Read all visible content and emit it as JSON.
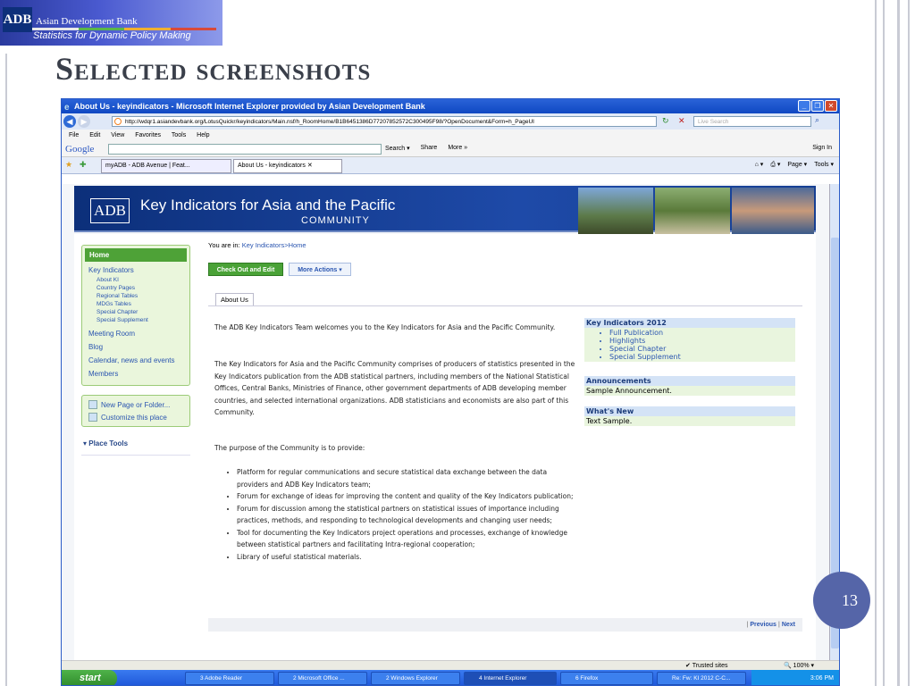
{
  "slide": {
    "logo_abbr": "ADB",
    "logo_name": "Asian Development Bank",
    "logo_tagline": "Statistics for Dynamic Policy Making",
    "title": "Selected screenshots",
    "page_number": "13"
  },
  "browser": {
    "window_title": "About Us - keyindicators - Microsoft Internet Explorer provided by Asian Development Bank",
    "url": "http://wdqr1.asiandevbank.org/LotusQuickr/keyindicators/Main.nsf/h_RoomHome/B1B6451386D77207852572C300495F98/?OpenDocument&Form=h_PageUI",
    "search_placeholder": "Live Search",
    "menu": [
      "File",
      "Edit",
      "View",
      "Favorites",
      "Tools",
      "Help"
    ],
    "google_logo": "Google",
    "google_tools": [
      "Search ▾",
      "Share",
      "More »"
    ],
    "sign_in": "Sign In",
    "tabs": [
      "myADB - ADB Avenue | Feat...",
      "About Us - keyindicators"
    ],
    "ie_tools": [
      "Page ▾",
      "Tools ▾"
    ],
    "status_zone": "Trusted sites",
    "zoom": "100%"
  },
  "site": {
    "banner_abbr": "ADB",
    "banner_title": "Key Indicators for Asia and the Pacific",
    "banner_subtitle": "COMMUNITY",
    "breadcrumb_prefix": "You are in:",
    "breadcrumb_link": "Key Indicators",
    "breadcrumb_current": ">Home",
    "btn_checkout": "Check Out and Edit",
    "btn_more": "More Actions ▾",
    "content_tab": "About Us",
    "sidebar": {
      "home": "Home",
      "key_indicators": "Key Indicators",
      "sub_items": [
        "About KI",
        "Country Pages",
        "Regional Tables",
        "MDGs Tables",
        "Special Chapter",
        "Special Supplement"
      ],
      "items": [
        "Meeting Room",
        "Blog",
        "Calendar, news and events",
        "Members"
      ],
      "tools": [
        "New Page or Folder...",
        "Customize this place"
      ],
      "place_tools": "▾ Place Tools"
    },
    "intro": "The ADB Key Indicators Team welcomes you to the Key Indicators for Asia and the Pacific Community.",
    "description": "The Key Indicators for Asia and the Pacific Community comprises of producers of statistics presented in the Key Indicators publication from the ADB statistical partners, including members of the National Statistical Offices, Central Banks, Ministries of Finance, other government departments of ADB developing member countries, and selected international organizations. ADB statisticians and economists are also part of this Community.",
    "purpose_lead": "The purpose of the Community is to provide:",
    "purposes": [
      "Platform for regular communications and secure statistical data exchange between the data providers and ADB Key Indicators team;",
      "Forum for exchange of ideas for improving the content and quality of the Key Indicators publication;",
      "Forum for discussion among the statistical partners on statistical issues of importance including practices, methods, and responding to technological developments and changing user needs;",
      "Tool for documenting the Key Indicators project operations and processes, exchange of knowledge between statistical partners and facilitating Intra-regional cooperation;",
      "Library of useful statistical materials."
    ],
    "right": {
      "ki_head": "Key Indicators 2012",
      "ki_links": [
        "Full Publication",
        "Highlights",
        "Special Chapter",
        "Special Supplement"
      ],
      "ann_head": "Announcements",
      "ann_body": "Sample Announcement.",
      "new_head": "What's New",
      "new_body": "Text Sample."
    },
    "previous": "Previous",
    "next": "Next"
  },
  "taskbar": {
    "start": "start",
    "buttons": [
      "3 Adobe Reader",
      "2 Microsoft Office ...",
      "2 Windows Explorer",
      "4 Internet Explorer",
      "6 Firefox",
      "Re: Fw: KI 2012 C-C..."
    ],
    "clock": "3:06 PM"
  }
}
